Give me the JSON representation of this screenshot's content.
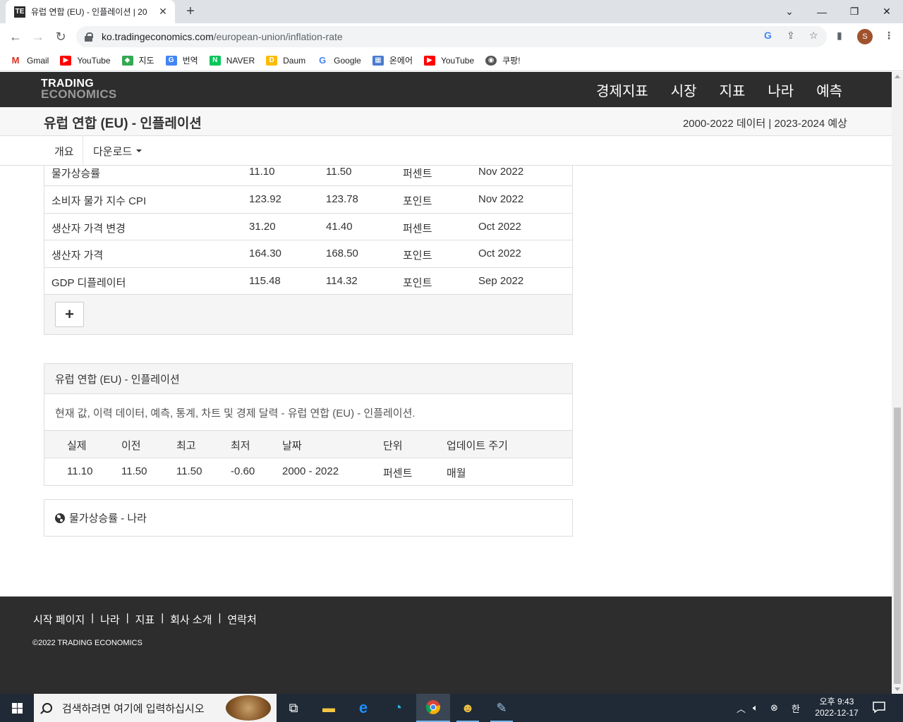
{
  "browser": {
    "tab_title": "유럽 연합 (EU) - 인플레이션 | 20",
    "url_host": "ko.tradingeconomics.com",
    "url_path": "/european-union/inflation-rate",
    "profile_initial": "S",
    "bookmarks": [
      "Gmail",
      "YouTube",
      "지도",
      "번역",
      "NAVER",
      "Daum",
      "Google",
      "온에어",
      "YouTube",
      "쿠팡!"
    ]
  },
  "site": {
    "logo_line1": "TRADING",
    "logo_line2": "ECONOMICS",
    "nav": [
      "경제지표",
      "시장",
      "지표",
      "나라",
      "예측"
    ]
  },
  "page": {
    "title": "유럽 연합 (EU) - 인플레이션",
    "data_range": "2000-2022 데이터 | 2023-2024 예상",
    "subnav": {
      "overview": "개요",
      "download": "다운로드"
    }
  },
  "related": {
    "rows": [
      {
        "name": "물가상승률",
        "last": "11.10",
        "previous": "11.50",
        "unit": "퍼센트",
        "date": "Nov 2022"
      },
      {
        "name": "소비자 물가 지수 CPI",
        "last": "123.92",
        "previous": "123.78",
        "unit": "포인트",
        "date": "Nov 2022"
      },
      {
        "name": "생산자 가격 변경",
        "last": "31.20",
        "previous": "41.40",
        "unit": "퍼센트",
        "date": "Oct 2022"
      },
      {
        "name": "생산자 가격",
        "last": "164.30",
        "previous": "168.50",
        "unit": "포인트",
        "date": "Oct 2022"
      },
      {
        "name": "GDP 디플레이터",
        "last": "115.48",
        "previous": "114.32",
        "unit": "포인트",
        "date": "Sep 2022"
      }
    ],
    "more_button": "+"
  },
  "summary": {
    "heading": "유럽 연합 (EU) - 인플레이션",
    "description": "현재 값, 이력 데이터, 예측, 통계, 차트 및 경제 달력 - 유럽 연합 (EU) - 인플레이션.",
    "headers": [
      "실제",
      "이전",
      "최고",
      "최저",
      "날짜",
      "단위",
      "업데이트 주기"
    ],
    "values": [
      "11.10",
      "11.50",
      "11.50",
      "-0.60",
      "2000 - 2022",
      "퍼센트",
      "매월"
    ]
  },
  "countries_link": "물가상승률 - 나라",
  "footer": {
    "links": [
      "시작 페이지",
      "나라",
      "지표",
      "회사 소개",
      "연락처"
    ],
    "copyright": "©2022 TRADING ECONOMICS"
  },
  "taskbar": {
    "search_placeholder": "검색하려면 여기에 입력하십시오",
    "ime": "한",
    "time": "오후 9:43",
    "date": "2022-12-17"
  }
}
